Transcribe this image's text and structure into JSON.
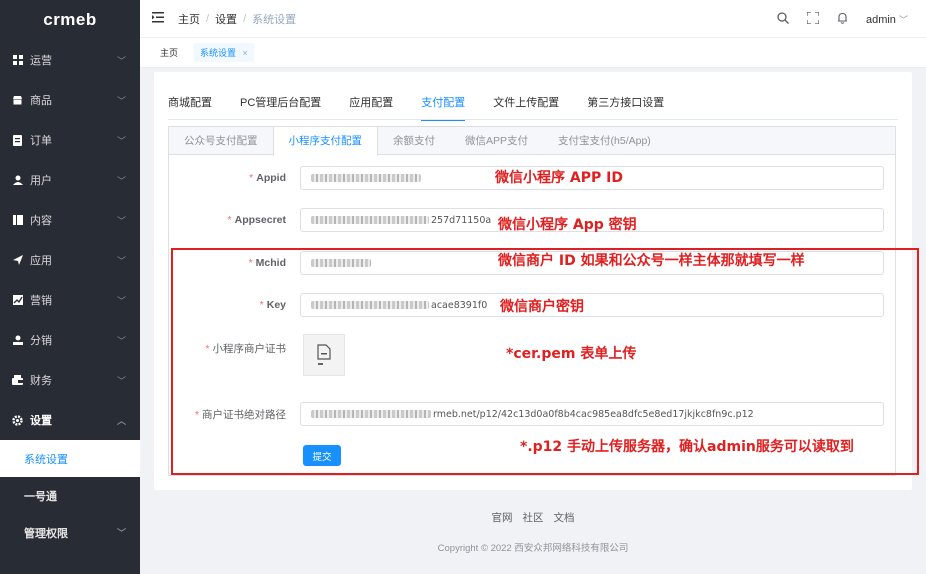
{
  "logo": "crmeb",
  "sidebar": {
    "items": [
      {
        "label": "运营",
        "icon": "grid-icon"
      },
      {
        "label": "商品",
        "icon": "shop-icon"
      },
      {
        "label": "订单",
        "icon": "order-icon"
      },
      {
        "label": "用户",
        "icon": "user-icon"
      },
      {
        "label": "内容",
        "icon": "content-icon"
      },
      {
        "label": "应用",
        "icon": "send-icon"
      },
      {
        "label": "营销",
        "icon": "chart-icon"
      },
      {
        "label": "分销",
        "icon": "distribution-icon"
      },
      {
        "label": "财务",
        "icon": "finance-icon"
      },
      {
        "label": "设置",
        "icon": "gear-icon"
      }
    ],
    "sub_active": "系统设置",
    "sub_2": "一号通",
    "sub_3": "管理权限"
  },
  "header": {
    "breadcrumb": [
      "主页",
      "设置",
      "系统设置"
    ],
    "user": "admin"
  },
  "tagbar": {
    "home": "主页",
    "active": "系统设置"
  },
  "top_tabs": [
    "商城配置",
    "PC管理后台配置",
    "应用配置",
    "支付配置",
    "文件上传配置",
    "第三方接口设置"
  ],
  "sub_tabs": [
    "公众号支付配置",
    "小程序支付配置",
    "余额支付",
    "微信APP支付",
    "支付宝支付(h5/App)"
  ],
  "form": {
    "appid_label": "Appid",
    "appsecret_label": "Appsecret",
    "appsecret_suffix": "257d71150a",
    "mchid_label": "Mchid",
    "key_label": "Key",
    "key_suffix": "acae8391f0",
    "cert_label": "小程序商户证书",
    "path_label": "商户证书绝对路径",
    "path_value": "rmeb.net/p12/42c13d0a0f8b4cac985ea8dfc5e8ed17jkjkc8fn9c.p12",
    "submit": "提交"
  },
  "annotations": {
    "appid": "微信小程序 APP ID",
    "appsecret": "微信小程序 App  密钥",
    "mchid": "微信商户 ID 如果和公众号一样主体那就填写一样",
    "key": "微信商户密钥",
    "cert": "*cer.pem 表单上传",
    "path": "*.p12 手动上传服务器，确认admin服务可以读取到"
  },
  "footer": {
    "links": [
      "官网",
      "社区",
      "文档"
    ],
    "copyright": "Copyright © 2022 西安众邦网络科技有限公司"
  },
  "colors": {
    "accent": "#1890ff",
    "annotation_red": "#e02020",
    "sidebar_bg": "#282c34"
  }
}
